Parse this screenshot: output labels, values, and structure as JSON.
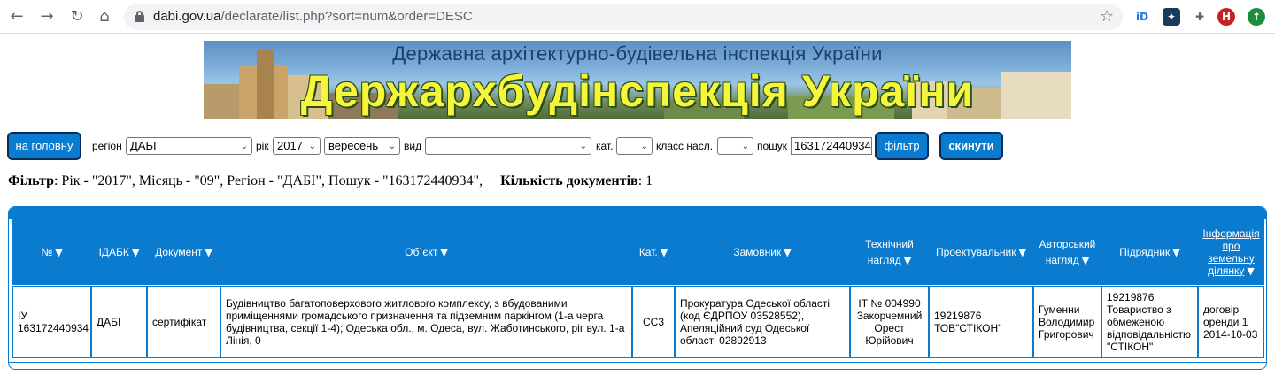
{
  "browser": {
    "url_domain": "dabi.gov.ua",
    "url_path": "/declarate/list.php?sort=num&order=DESC",
    "profile_initial": "H",
    "ext1": "iD"
  },
  "banner": {
    "subtitle": "Державна архітектурно-будівельна інспекція України",
    "title": "Держархбудінспекція України"
  },
  "filters": {
    "home_button": "на головну",
    "region_label": "регіон",
    "region_value": "ДАБІ",
    "year_label": "рік",
    "year_value": "2017",
    "month_value": "вересень",
    "type_label": "вид",
    "type_value": "",
    "cat_label": "кат.",
    "cat_value": "",
    "class_label": "класс насл.",
    "class_value": "",
    "search_label": "пошук",
    "search_value": "163172440934",
    "filter_button": "фільтр",
    "reset_button": "скинути"
  },
  "summary": {
    "filter_label": "Фільтр",
    "filter_text": ": Рік - \"2017\", Місяць - \"09\", Регіон - \"ДАБІ\", Пошук - \"163172440934\",",
    "count_label": "Кількість документів",
    "count_value": ": 1"
  },
  "table": {
    "headers": {
      "num": "№",
      "idabk": "ІДАБК",
      "doc": "Документ",
      "object": "Об`єкт",
      "cat": "Кат.",
      "customer": "Замовник",
      "tech_1": "Технічний",
      "tech_2": "нагляд",
      "designer": "Проектувальник",
      "author_1": "Авторський",
      "author_2": "нагляд",
      "contractor": "Підрядник",
      "land_1": "Інформація",
      "land_2": "про",
      "land_3": "земельну",
      "land_4": "ділянку"
    },
    "row": {
      "num": "ІУ 163172440934",
      "idabk": "ДАБІ",
      "doc": "сертифікат",
      "object": "Будівництво багатоповерхового житлового комплексу, з вбудованими приміщеннями громадського призначення та підземним паркінгом (1-а черга будівництва, секції 1-4); Одеська обл., м. Одеса, вул. Жаботинського, ріг вул. 1-а Лінія, 0",
      "cat": "СС3",
      "customer": "Прокуратура Одеської області (код ЄДРПОУ 03528552), Апеляційний суд Одеської області 02892913",
      "tech": "ІТ № 004990 Закорчемний Орест Юрійович",
      "designer": "19219876 ТОВ\"СТІКОН\"",
      "author": "Гуменни Володимир Григорович",
      "contractor": "19219876 Товариство з обмеженою відповідальністю \"СТІКОН\"",
      "land": "договір оренди 1 2014-10-03"
    }
  },
  "colors": {
    "accent": "#0b7bd0",
    "border_dark": "#0a2a57"
  },
  "icons": [
    "back-arrow-icon",
    "forward-arrow-icon",
    "reload-icon",
    "home-icon",
    "lock-icon",
    "bookmark-star-icon",
    "puzzle-icon",
    "sort-desc-triangle-icon"
  ]
}
